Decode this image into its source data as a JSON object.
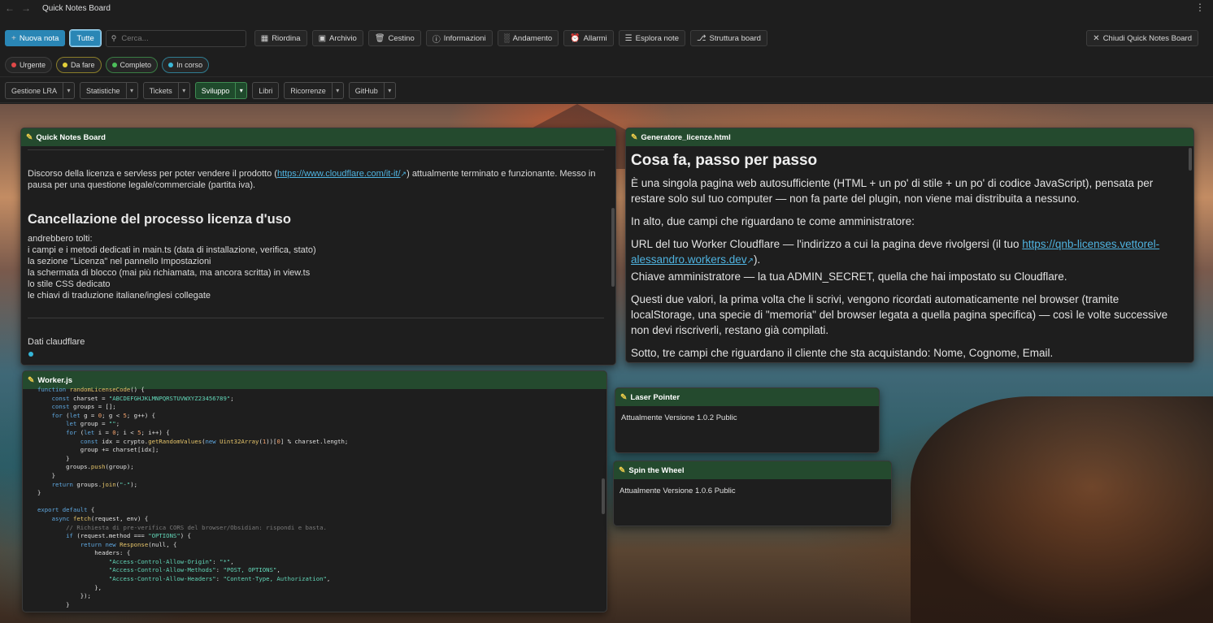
{
  "window": {
    "title": "Quick Notes Board",
    "back": "←",
    "forward": "→",
    "more": "⋮"
  },
  "toolbar": {
    "new_note": "Nuova nota",
    "all": "Tutte",
    "search_placeholder": "Cerca...",
    "buttons": [
      "Riordina",
      "Archivio",
      "Cestino",
      "Informazioni",
      "Andamento",
      "Allarmi",
      "Esplora note",
      "Struttura board"
    ],
    "close_board": "Chiudi Quick Notes Board"
  },
  "status_chips": [
    {
      "label": "Urgente",
      "color": "#e04848"
    },
    {
      "label": "Da fare",
      "color": "#e3cf3a"
    },
    {
      "label": "Completo",
      "color": "#4cbf5a"
    },
    {
      "label": "In corso",
      "color": "#3bb8d8"
    }
  ],
  "tabs": [
    {
      "label": "Gestione LRA",
      "caret": true
    },
    {
      "label": "Statistiche",
      "caret": true
    },
    {
      "label": "Tickets",
      "caret": true
    },
    {
      "label": "Sviluppo",
      "caret": true,
      "selected": true
    },
    {
      "label": "Libri",
      "caret": false
    },
    {
      "label": "Ricorrenze",
      "caret": true
    },
    {
      "label": "GitHub",
      "caret": true
    }
  ],
  "notes": {
    "qnb": {
      "title": "Quick Notes Board",
      "p1_before": "Discorso della licenza e servless per poter vendere il prodotto (",
      "p1_link": "https://www.cloudflare.com/it-it/",
      "p1_after": ") attualmente terminato e funzionante. Messo in pausa per una questione legale/commerciale (partita iva).",
      "heading": "Cancellazione del processo licenza d'uso",
      "lines": [
        "andrebbero tolti:",
        "i campi e i metodi dedicati in main.ts (data di installazione, verifica, stato)",
        "la sezione \"Licenza\" nel pannello Impostazioni",
        "la schermata di blocco (mai più richiamata, ma ancora scritta) in view.ts",
        "lo stile CSS dedicato",
        "le chiavi di traduzione italiane/inglesi collegate"
      ],
      "p3": "Dati claudflare"
    },
    "gen": {
      "title": "Generatore_licenze.html",
      "heading": "Cosa fa, passo per passo",
      "p1": "È una singola pagina web autosufficiente (HTML + un po' di stile + un po' di codice JavaScript), pensata per restare solo sul tuo computer — non fa parte del plugin, non viene mai distribuita a nessuno.",
      "p2": "In alto, due campi che riguardano te come amministratore:",
      "p3_before": "URL del tuo Worker Cloudflare — l'indirizzo a cui la pagina deve rivolgersi (il tuo ",
      "p3_link": "https://qnb-licenses.vettorel-alessandro.workers.dev",
      "p3_after": ").",
      "p3_line2": "Chiave amministratore — la tua ADMIN_SECRET, quella che hai impostato su Cloudflare.",
      "p4": "Questi due valori, la prima volta che li scrivi, vengono ricordati automaticamente nel browser (tramite localStorage, una specie di \"memoria\" del browser legata a quella pagina specifica) — così le volte successive non devi riscriverli, restano già compilati.",
      "p5": "Sotto, tre campi che riguardano il cliente che sta acquistando: Nome, Cognome, Email."
    },
    "worker": {
      "title": "Worker.js",
      "code": [
        "function randomLicenseCode() {",
        "    const charset = \"ABCDEFGHJKLMNPQRSTUVWXYZ23456789\";",
        "    const groups = [];",
        "    for (let g = 0; g < 5; g++) {",
        "        let group = \"\";",
        "        for (let i = 0; i < 5; i++) {",
        "            const idx = crypto.getRandomValues(new Uint32Array(1))[0] % charset.length;",
        "            group += charset[idx];",
        "        }",
        "        groups.push(group);",
        "    }",
        "    return groups.join(\"-\");",
        "}",
        "",
        "export default {",
        "    async fetch(request, env) {",
        "        // Richiesta di pre-verifica CORS del browser/Obsidian: rispondi e basta.",
        "        if (request.method === \"OPTIONS\") {",
        "            return new Response(null, {",
        "                headers: {",
        "                    \"Access-Control-Allow-Origin\": \"*\",",
        "                    \"Access-Control-Allow-Methods\": \"POST, OPTIONS\",",
        "                    \"Access-Control-Allow-Headers\": \"Content-Type, Authorization\",",
        "                },",
        "            });",
        "        }"
      ]
    },
    "laser": {
      "title": "Laser Pointer",
      "text": "Attualmente Versione 1.0.2 Public"
    },
    "spin": {
      "title": "Spin the Wheel",
      "text": "Attualmente Versione 1.0.6 Public"
    }
  }
}
